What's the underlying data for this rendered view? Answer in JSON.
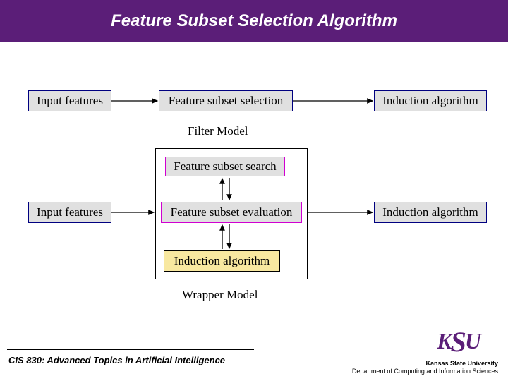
{
  "title": "Feature Subset Selection Algorithm",
  "filter": {
    "input_features": "Input features",
    "feature_subset_selection": "Feature subset selection",
    "induction_algorithm": "Induction algorithm",
    "label": "Filter Model"
  },
  "wrapper": {
    "input_features": "Input features",
    "feature_subset_search": "Feature subset search",
    "feature_subset_evaluation": "Feature subset evaluation",
    "induction_algorithm_inner": "Induction algorithm",
    "induction_algorithm_outer": "Induction algorithm",
    "label": "Wrapper Model"
  },
  "footer": {
    "course": "CIS 830: Advanced Topics in Artificial Intelligence",
    "university": "Kansas State University",
    "department": "Department of Computing and Information Sciences",
    "logo": "KSU"
  }
}
